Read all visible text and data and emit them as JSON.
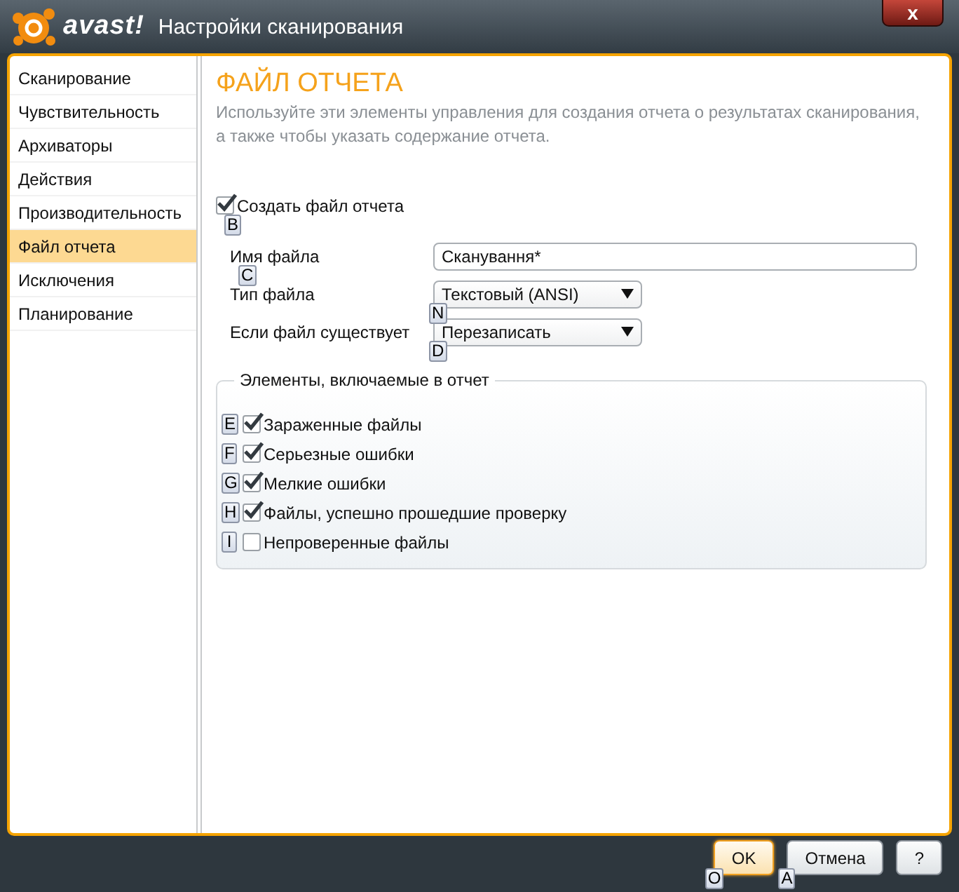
{
  "window": {
    "logo": "avast!",
    "title": "Настройки сканирования",
    "close": "x"
  },
  "sidebar": {
    "items": [
      {
        "label": "Сканирование",
        "selected": false
      },
      {
        "label": "Чувствительность",
        "selected": false
      },
      {
        "label": "Архиваторы",
        "selected": false
      },
      {
        "label": "Действия",
        "selected": false
      },
      {
        "label": "Производительность",
        "selected": false
      },
      {
        "label": "Файл отчета",
        "selected": true
      },
      {
        "label": "Исключения",
        "selected": false
      },
      {
        "label": "Планирование",
        "selected": false
      }
    ]
  },
  "section": {
    "title": "ФАЙЛ ОТЧЕТА",
    "description": "Используйте эти элементы управления для создания отчета о результатах сканирования, а также чтобы указать содержание отчета."
  },
  "create_report": {
    "label": "Создать файл отчета",
    "checked": true,
    "hint": "B"
  },
  "fields": [
    {
      "kind": "text",
      "label": "Имя файла",
      "label_hint": "C",
      "value": "Сканування*"
    },
    {
      "kind": "select",
      "label": "Тип файла",
      "value": "Текстовый (ANSI)",
      "hint": "N"
    },
    {
      "kind": "select",
      "label": "Если файл существует",
      "value": "Перезаписать",
      "hint": "D"
    }
  ],
  "report_items": {
    "title": "Элементы, включаемые в отчет",
    "items": [
      {
        "label": "Зараженные файлы",
        "checked": true,
        "hint": "E"
      },
      {
        "label": "Серьезные ошибки",
        "checked": true,
        "hint": "F"
      },
      {
        "label": "Мелкие ошибки",
        "checked": true,
        "hint": "G"
      },
      {
        "label": "Файлы, успешно прошедшие проверку",
        "checked": true,
        "hint": "H"
      },
      {
        "label": "Непроверенные файлы",
        "checked": false,
        "hint": "I"
      }
    ]
  },
  "buttons": [
    {
      "label": "OK",
      "hint": "O",
      "default": true
    },
    {
      "label": "Отмена",
      "hint": "A",
      "default": false
    },
    {
      "label": "?",
      "default": false
    }
  ]
}
